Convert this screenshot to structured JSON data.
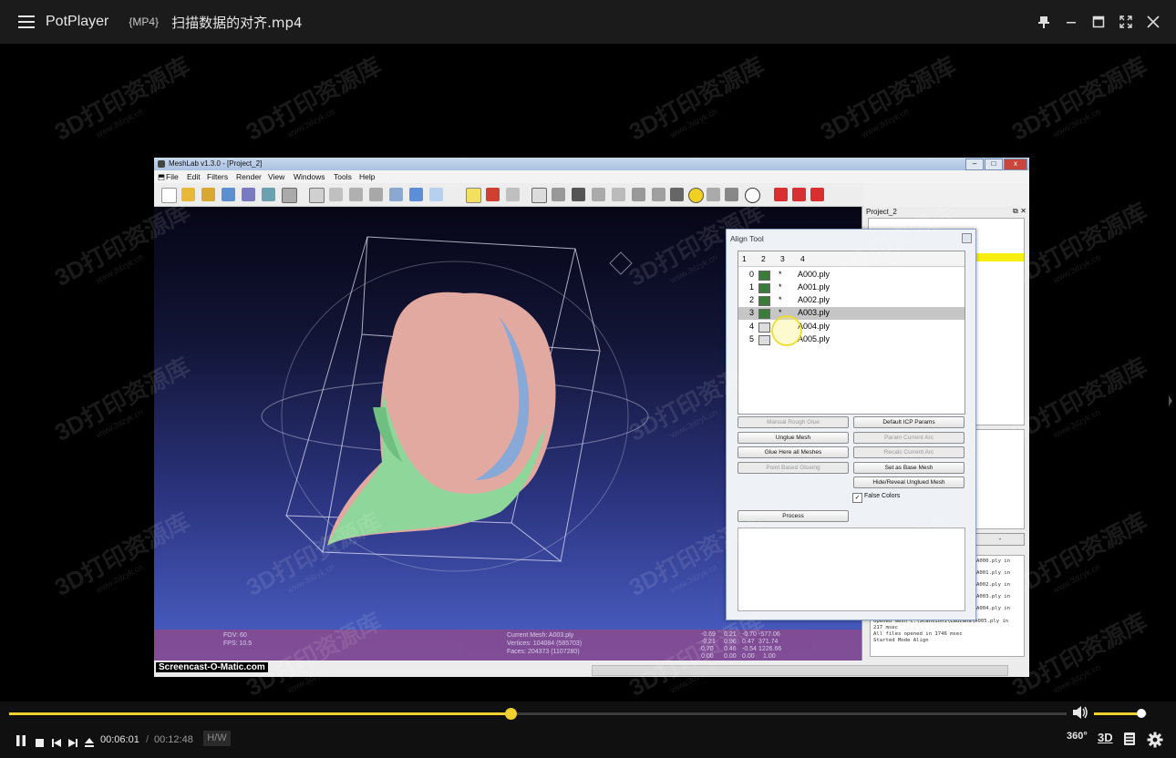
{
  "titlebar": {
    "app_name": "PotPlayer",
    "format_tag": "{MP4}",
    "file_name": "扫描数据的对齐.mp4"
  },
  "video_frame": {
    "meshlab": {
      "window_title": "MeshLab v1.3.0 - [Project_2]",
      "menu": [
        "File",
        "Edit",
        "Filters",
        "Render",
        "View",
        "Windows",
        "Tools",
        "Help"
      ],
      "dock_title": "Project_2",
      "info_left": [
        "FOV: 60",
        "FPS:   10.5"
      ],
      "info_center": [
        "Current Mesh: A003.ply",
        "Vertices: 104084 (585703)",
        "Faces: 204373 (1107280)"
      ],
      "matrix": [
        [
          "-0.69",
          "0.21",
          "-0.70",
          "-577.06"
        ],
        [
          "-0.21",
          "0.96",
          "0.47",
          "371.74"
        ],
        [
          "0.70",
          "0.46",
          "-0.54",
          "1226.66"
        ],
        [
          "0.00",
          "0.00",
          "0.00",
          "1.00"
        ]
      ],
      "screencast_label": "Screencast-O-Matic.com",
      "log_lines": [
        "A000.ply in",
        "A001.ply in",
        "A002.ply in",
        "A003.ply in",
        "A004.ply in",
        "Opened mesh C:\\Scansioni\\Lauzana\\A005.ply in",
        "217 msec",
        "All files opened in 1746 msec",
        "Started Mode Align"
      ]
    },
    "align_tool": {
      "title": "Align Tool",
      "columns": [
        "1",
        "2",
        "3",
        "4"
      ],
      "rows": [
        {
          "index": "0",
          "mark": "*",
          "name": "A000.ply",
          "visible": true
        },
        {
          "index": "1",
          "mark": "*",
          "name": "A001.ply",
          "visible": true
        },
        {
          "index": "2",
          "mark": "*",
          "name": "A002.ply",
          "visible": true
        },
        {
          "index": "3",
          "mark": "*",
          "name": "A003.ply",
          "visible": true,
          "selected": true
        },
        {
          "index": "4",
          "mark": "",
          "name": "A004.ply",
          "visible": false
        },
        {
          "index": "5",
          "mark": "",
          "name": "A005.ply",
          "visible": false
        }
      ],
      "buttons": {
        "manual_rough_glue": "Manual Rough Glue",
        "default_icp_params": "Default ICP Params",
        "unglue_mesh": "Unglue Mesh",
        "param_current_arc": "Param Current Arc",
        "glue_all": "Glue Here all Meshes",
        "recalc_current_arc": "Recalc Current Arc",
        "point_based_glueing": "Point Based Glueing",
        "set_as_base_mesh": "Set as Base Mesh",
        "hide_reveal": "Hide/Reveal Unglued Mesh",
        "process": "Process"
      },
      "false_colors_label": "False Colors",
      "false_colors_checked": true
    },
    "watermark_text": "3D打印资源库",
    "watermark_url": "www.3dzyk.cn"
  },
  "player": {
    "current_time": "00:06:01",
    "separator": "/",
    "total_time": "00:12:48",
    "progress": 0.474,
    "hw_label": "H/W",
    "volume": 0.9,
    "btn_360": "360°",
    "btn_3d": "3D",
    "accent": "#f0d030"
  }
}
